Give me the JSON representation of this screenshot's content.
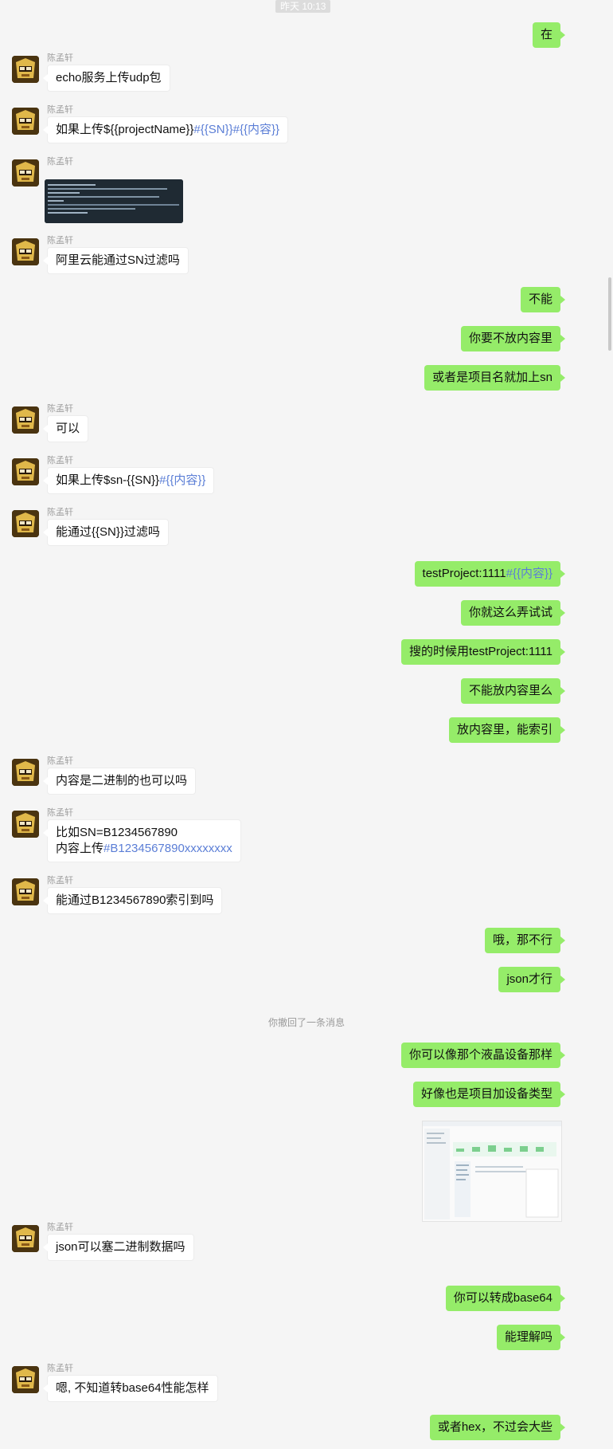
{
  "chat": {
    "timestamp": "昨天 10:13",
    "recalled_notice": "你撤回了一条消息",
    "contact_name": "陈孟轩",
    "messages": [
      {
        "dir": "out",
        "text": "在"
      },
      {
        "dir": "in",
        "text": "echo服务上传udp包"
      },
      {
        "dir": "in",
        "parts": [
          {
            "t": "如果上传${{projectName}}"
          },
          {
            "t": "#{{SN}}#{{内容}}",
            "hl": true
          }
        ]
      },
      {
        "dir": "in",
        "type": "image",
        "alt": "terminal-screenshot"
      },
      {
        "dir": "in",
        "text": "阿里云能通过SN过滤吗"
      },
      {
        "dir": "out",
        "text": "不能"
      },
      {
        "dir": "out",
        "text": "你要不放内容里"
      },
      {
        "dir": "out",
        "text": "或者是项目名就加上sn"
      },
      {
        "dir": "in",
        "text": "可以"
      },
      {
        "dir": "in",
        "parts": [
          {
            "t": "如果上传$sn-{{SN}}"
          },
          {
            "t": "#{{内容}}",
            "hl": true
          }
        ]
      },
      {
        "dir": "in",
        "text": "能通过{{SN}}过滤吗"
      },
      {
        "dir": "out",
        "parts": [
          {
            "t": "testProject:1111"
          },
          {
            "t": "#{{内容}}",
            "hl": true
          }
        ]
      },
      {
        "dir": "out",
        "text": "你就这么弄试试"
      },
      {
        "dir": "out",
        "text": "搜的时候用testProject:1111"
      },
      {
        "dir": "out",
        "text": "不能放内容里么"
      },
      {
        "dir": "out",
        "text": "放内容里，能索引"
      },
      {
        "dir": "in",
        "text": "内容是二进制的也可以吗"
      },
      {
        "dir": "in",
        "line1": "比如SN=B1234567890",
        "line2_a": "内容上传",
        "line2_b": "#B1234567890xxxxxxxx"
      },
      {
        "dir": "in",
        "text": "能通过B1234567890索引到吗"
      },
      {
        "dir": "out",
        "text": "哦，那不行"
      },
      {
        "dir": "out",
        "text": "json才行"
      },
      {
        "dir": "out",
        "text": "你可以像那个液晶设备那样"
      },
      {
        "dir": "out",
        "text": "好像也是项目加设备类型"
      },
      {
        "dir": "out",
        "type": "image",
        "alt": "console-screenshot"
      },
      {
        "dir": "in",
        "text": "json可以塞二进制数据吗"
      },
      {
        "dir": "out",
        "text": "你可以转成base64"
      },
      {
        "dir": "out",
        "text": "能理解吗"
      },
      {
        "dir": "in",
        "text": "嗯, 不知道转base64性能怎样"
      },
      {
        "dir": "out",
        "text": "或者hex，不过会大些"
      }
    ]
  },
  "colors": {
    "background": "#f5f5f5",
    "outgoing_bubble": "#95ec69",
    "incoming_bubble": "#ffffff",
    "highlight_text": "#5b7ed6"
  }
}
